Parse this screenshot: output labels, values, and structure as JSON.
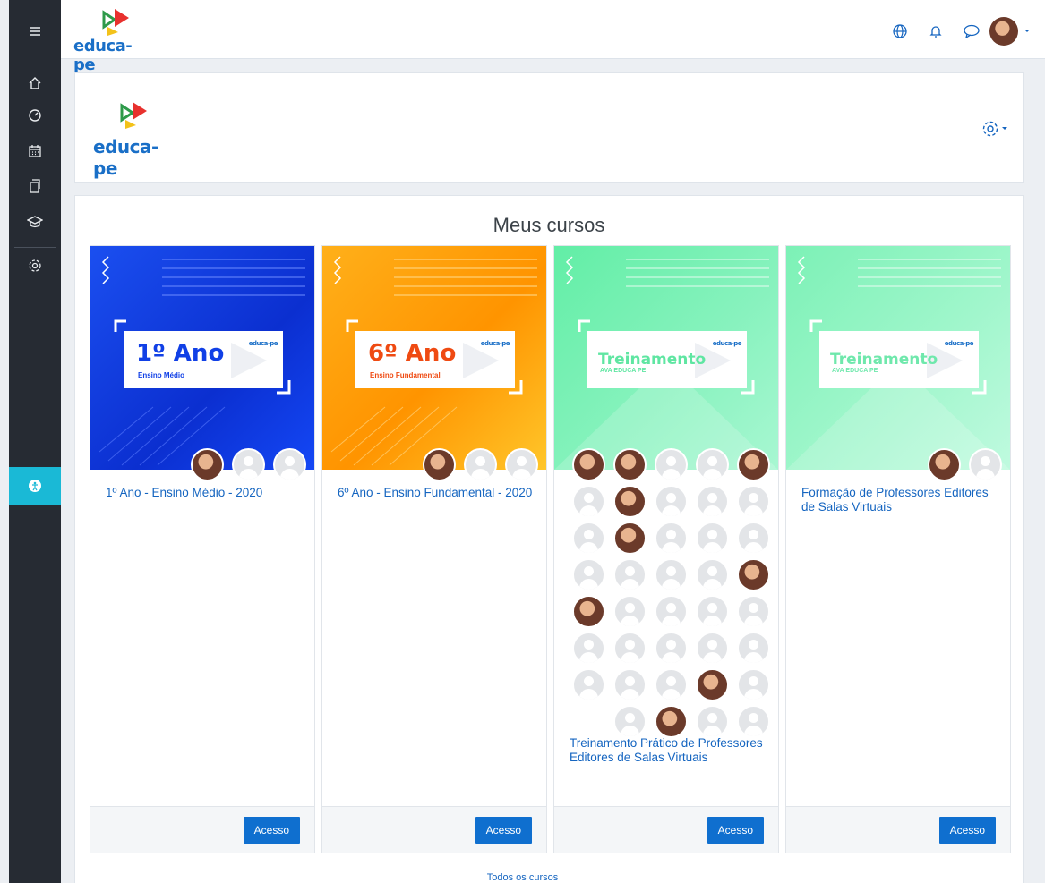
{
  "brand": {
    "name": "educa-pe"
  },
  "rail": {
    "items": [
      "menu-icon",
      "home-icon",
      "dashboard-icon",
      "calendar-icon",
      "files-icon",
      "courses-icon",
      "settings-icon"
    ],
    "accessibility": "accessibility-icon"
  },
  "topbar": {
    "icons": [
      "language-icon",
      "notifications-icon",
      "messages-icon"
    ]
  },
  "panel": {
    "title": "Meus cursos"
  },
  "courses": [
    {
      "title": "1º Ano - Ensino Médio - 2020",
      "banner_big": "1º Ano",
      "banner_small": "Ensino Médio",
      "color": "#0f3fe0",
      "button": "Acesso"
    },
    {
      "title": "6º Ano - Ensino Fundamental - 2020",
      "banner_big": "6º Ano",
      "banner_small": "Ensino Fundamental",
      "color": "#ffa61a",
      "button": "Acesso"
    },
    {
      "title": "Treinamento Prático de Professores Editores de Salas Virtuais",
      "banner_big": "Treinamento",
      "banner_small": "AVA EDUCA PE",
      "color": "#6ff0b0",
      "button": "Acesso"
    },
    {
      "title": "Formação de Professores Editores de Salas Virtuais",
      "banner_big": "Treinamento",
      "banner_small": "AVA EDUCA PE",
      "color": "#8ef6c4",
      "button": "Acesso"
    }
  ],
  "footer": {
    "all_courses": "Todos os cursos"
  }
}
